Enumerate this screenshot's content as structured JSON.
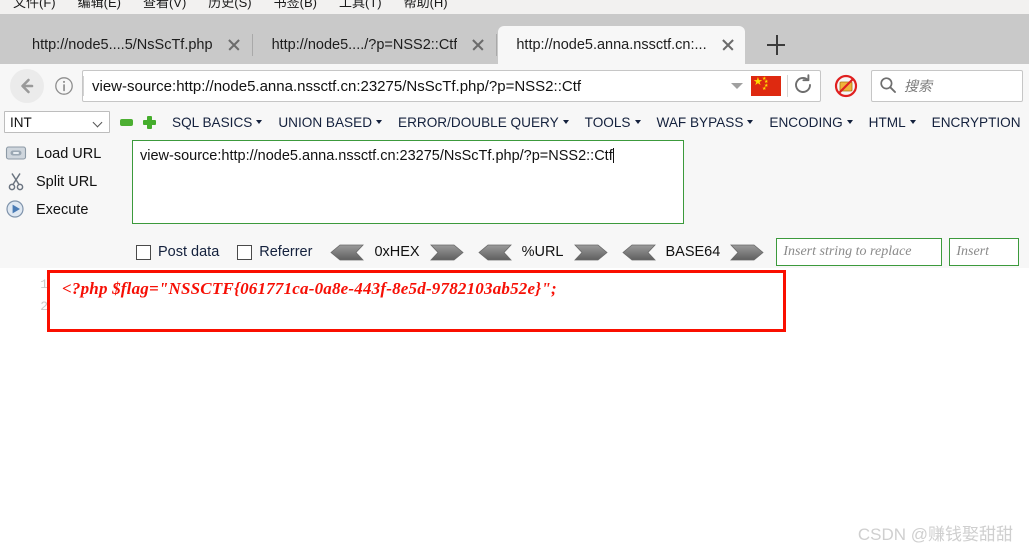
{
  "menubar": {
    "items": [
      {
        "label": "文件(F)"
      },
      {
        "label": "编辑(E)"
      },
      {
        "label": "查看(V)"
      },
      {
        "label": "历史(S)"
      },
      {
        "label": "书签(B)"
      },
      {
        "label": "工具(T)"
      },
      {
        "label": "帮助(H)"
      }
    ]
  },
  "tabs": {
    "items": [
      {
        "label": "http://node5....5/NsScTf.php",
        "active": false
      },
      {
        "label": "http://node5..../?p=NSS2::Ctf",
        "active": false
      },
      {
        "label": "http://node5.anna.nssctf.cn:...",
        "active": true
      }
    ],
    "new_tab_label": "+"
  },
  "navbar": {
    "back_icon": "back-arrow-icon",
    "info_icon": "page-info-icon",
    "url": "view-source:http://node5.anna.nssctf.cn:23275/NsScTf.php/?p=NSS2::Ctf",
    "dropdown_icon": "chevron-down-icon",
    "flag_icon": "china-flag-icon",
    "reload_icon": "reload-icon",
    "noscript_icon": "noscript-blocked-icon",
    "search_icon": "search-icon",
    "search_placeholder": "搜索"
  },
  "hackbar": {
    "type_select": {
      "value": "INT",
      "chevron": "chevron-down-icon"
    },
    "minus_label": "collapse-button",
    "plus_label": "add-button",
    "menus": [
      {
        "label": "SQL BASICS"
      },
      {
        "label": "UNION BASED"
      },
      {
        "label": "ERROR/DOUBLE QUERY"
      },
      {
        "label": "TOOLS"
      },
      {
        "label": "WAF BYPASS"
      },
      {
        "label": "ENCODING"
      },
      {
        "label": "HTML"
      },
      {
        "label": "ENCRYPTION"
      }
    ],
    "actions": [
      {
        "label": "Load URL",
        "icon": "load-url-icon"
      },
      {
        "label": "Split URL",
        "icon": "scissors-icon"
      },
      {
        "label": "Execute",
        "icon": "execute-play-icon"
      }
    ],
    "url_value": "view-source:http://node5.anna.nssctf.cn:23275/NsScTf.php/?p=NSS2::Ctf",
    "options": {
      "post_data_label": "Post data",
      "referrer_label": "Referrer",
      "encoders": [
        {
          "label": "0xHEX"
        },
        {
          "label": "%URL"
        },
        {
          "label": "BASE64"
        }
      ],
      "replace_from_placeholder": "Insert string to replace",
      "replace_to_placeholder": "Insert"
    }
  },
  "source_view": {
    "line_numbers": [
      "1",
      "2"
    ],
    "code": "<?php $flag=\"NSSCTF{061771ca-0a8e-443f-8e5d-9782103ab52e}\";",
    "highlight_color": "#fa0f00"
  },
  "watermark": {
    "text": "CSDN @赚钱娶甜甜"
  }
}
